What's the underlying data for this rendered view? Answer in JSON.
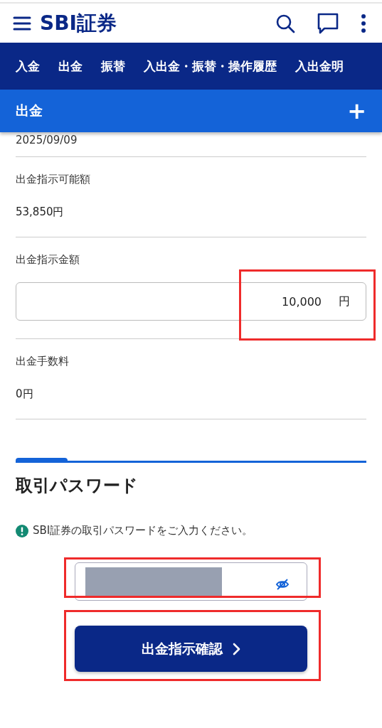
{
  "header": {
    "logo": "SBI証券"
  },
  "nav_tabs": [
    {
      "label": "入金",
      "selected": false
    },
    {
      "label": "出金",
      "selected": false
    },
    {
      "label": "振替",
      "selected": false
    },
    {
      "label": "入出金・振替・操作履歴",
      "selected": false
    },
    {
      "label": "入出金明",
      "selected": false
    }
  ],
  "section": {
    "title": "出金",
    "expand_icon": "+"
  },
  "date": "2025/09/09",
  "fields": [
    {
      "kind": "display",
      "label": "出金指示可能額",
      "value": "53,850円"
    },
    {
      "kind": "input",
      "label": "出金指示金額",
      "value": "10,000",
      "unit": "円",
      "highlighted": true
    },
    {
      "kind": "display",
      "label": "出金手数料",
      "value": "0円"
    }
  ],
  "password_section": {
    "title": "取引パスワード",
    "notice": "SBI証券の取引パスワードをご入力ください。",
    "field": {
      "masked": true,
      "highlighted": true
    }
  },
  "confirm_button": {
    "label": "出金指示確認",
    "highlighted": true
  }
}
